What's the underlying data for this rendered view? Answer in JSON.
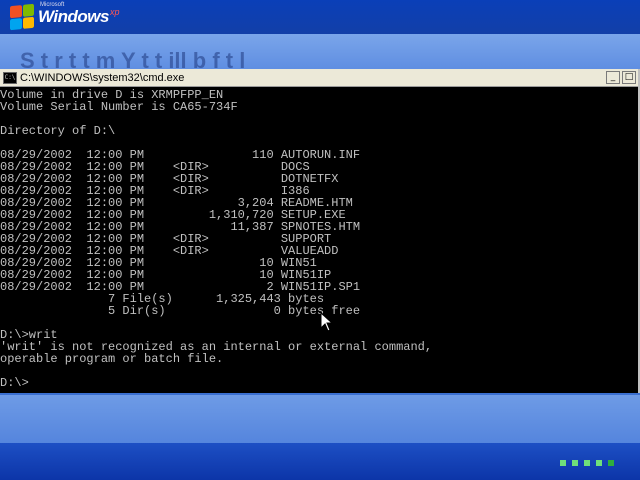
{
  "brand": {
    "microsoft": "Microsoft",
    "windows": "Windows",
    "xp": "xp"
  },
  "background_text": "S  t  r  t  t      m        Y        t      t      ill  b    f  t      l",
  "window": {
    "title": "C:\\WINDOWS\\system32\\cmd.exe"
  },
  "console": {
    "lines": [
      "Volume in drive D is XRMPFPP_EN",
      "Volume Serial Number is CA65-734F",
      "",
      "Directory of D:\\",
      "",
      "08/29/2002  12:00 PM               110 AUTORUN.INF",
      "08/29/2002  12:00 PM    <DIR>          DOCS",
      "08/29/2002  12:00 PM    <DIR>          DOTNETFX",
      "08/29/2002  12:00 PM    <DIR>          I386",
      "08/29/2002  12:00 PM             3,204 README.HTM",
      "08/29/2002  12:00 PM         1,310,720 SETUP.EXE",
      "08/29/2002  12:00 PM            11,387 SPNOTES.HTM",
      "08/29/2002  12:00 PM    <DIR>          SUPPORT",
      "08/29/2002  12:00 PM    <DIR>          VALUEADD",
      "08/29/2002  12:00 PM                10 WIN51",
      "08/29/2002  12:00 PM                10 WIN51IP",
      "08/29/2002  12:00 PM                 2 WIN51IP.SP1",
      "               7 File(s)      1,325,443 bytes",
      "               5 Dir(s)               0 bytes free",
      "",
      "D:\\>writ",
      "'writ' is not recognized as an internal or external command,",
      "operable program or batch file.",
      "",
      "D:\\>"
    ]
  },
  "colors": {
    "console_bg": "#000000",
    "console_fg": "#c0c0c0",
    "desktop_blue": "#3a6fd0",
    "progress_green": "#2fae3e"
  },
  "progress": {
    "total": 5,
    "active": 4
  }
}
